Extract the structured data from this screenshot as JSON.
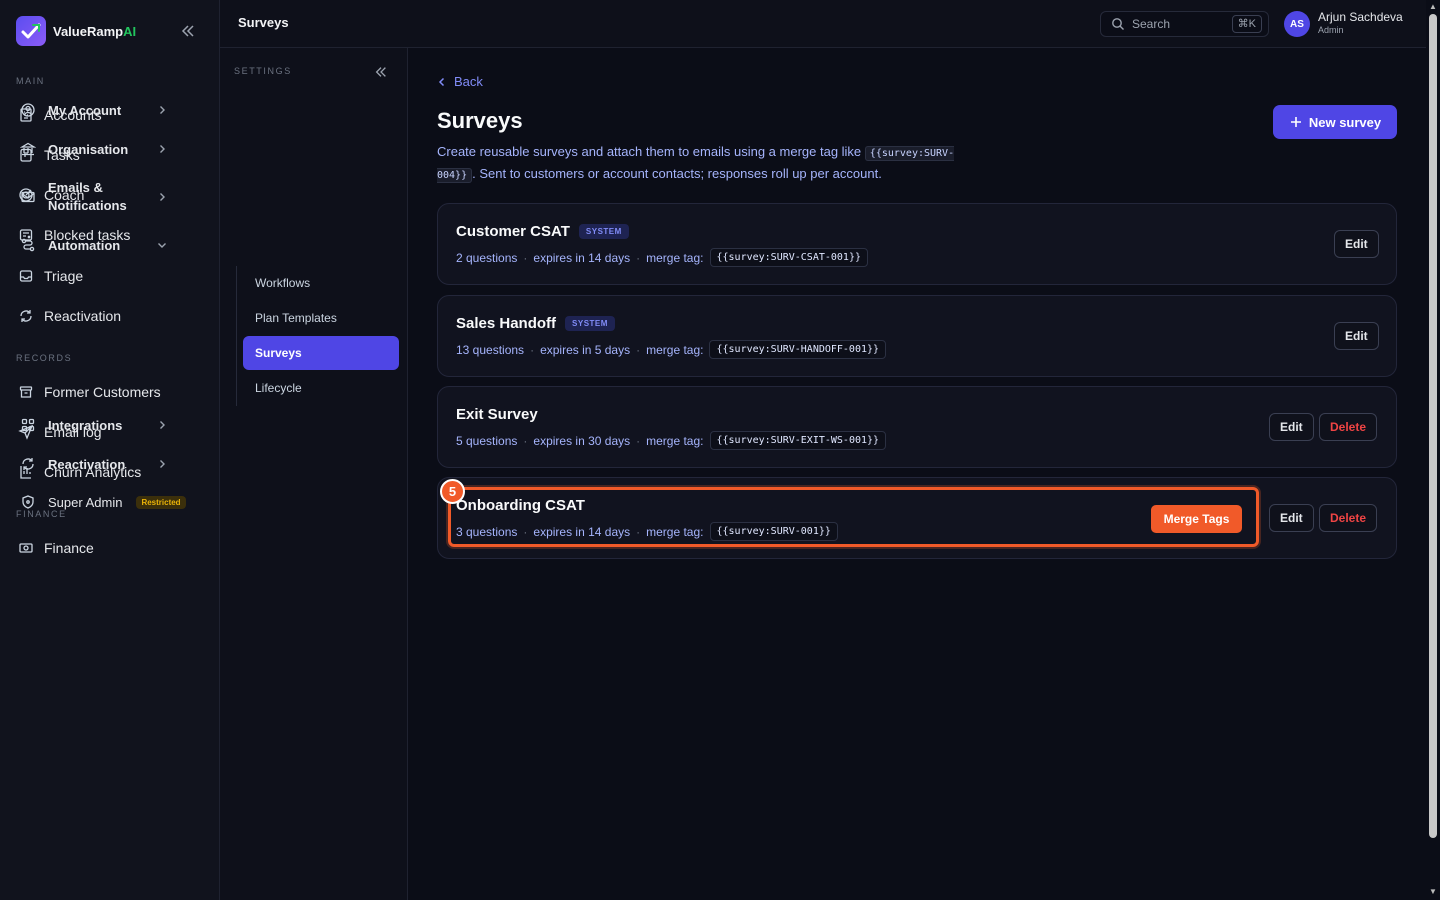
{
  "app": {
    "brand_main": "ValueRamp",
    "brand_ai": "AI"
  },
  "sidebar": {
    "sections": [
      {
        "label": "MAIN"
      },
      {
        "label": "RECORDS"
      },
      {
        "label": "FINANCE"
      }
    ],
    "items": [
      {
        "label": "Accounts",
        "icon": "building-icon"
      },
      {
        "label": "Tasks",
        "icon": "clipboard-icon"
      },
      {
        "label": "Coach",
        "icon": "target-icon"
      },
      {
        "label": "Blocked tasks",
        "icon": "blocked-icon"
      },
      {
        "label": "Triage",
        "icon": "inbox-icon"
      },
      {
        "label": "Reactivation",
        "icon": "refresh-icon"
      },
      {
        "label": "Former Customers",
        "icon": "archive-icon"
      },
      {
        "label": "Email log",
        "icon": "send-icon"
      },
      {
        "label": "Churn Analytics",
        "icon": "chart-icon"
      },
      {
        "label": "Finance",
        "icon": "banknote-icon"
      }
    ]
  },
  "topbar": {
    "title": "Surveys",
    "search_label": "Search",
    "shortcut": "⌘K",
    "user_initials": "AS",
    "user_name": "Arjun Sachdeva",
    "user_role": "Admin"
  },
  "settings": {
    "label": "SETTINGS",
    "items": [
      {
        "label": "My Account"
      },
      {
        "label": "Organisation"
      },
      {
        "label": "Emails & Notifications"
      },
      {
        "label": "Automation"
      },
      {
        "label": "Integrations"
      },
      {
        "label": "Reactivation"
      },
      {
        "label": "Super Admin",
        "badge": "Restricted"
      }
    ],
    "automation_sub": [
      {
        "label": "Workflows"
      },
      {
        "label": "Plan Templates"
      },
      {
        "label": "Surveys"
      },
      {
        "label": "Lifecycle"
      }
    ]
  },
  "main": {
    "back_label": "Back",
    "title": "Surveys",
    "desc_before": "Create reusable surveys and attach them to emails using a merge tag like",
    "desc_code": "{{survey:SURV-004}}",
    "desc_after": ". Sent to customers or account contacts; responses roll up per account.",
    "new_button": "New survey",
    "merge_tag_label": "merge tag:",
    "edit_label": "Edit",
    "delete_label": "Delete",
    "surveys": [
      {
        "title": "Customer CSAT",
        "badge": "SYSTEM",
        "questions": "2 questions",
        "expires": "expires in 14 days",
        "tag": "{{survey:SURV-CSAT-001}}"
      },
      {
        "title": "Sales Handoff",
        "badge": "SYSTEM",
        "questions": "13 questions",
        "expires": "expires in 5 days",
        "tag": "{{survey:SURV-HANDOFF-001}}"
      },
      {
        "title": "Exit Survey",
        "badge": "",
        "questions": "5 questions",
        "expires": "expires in 30 days",
        "tag": "{{survey:SURV-EXIT-WS-001}}"
      },
      {
        "title": "Onboarding CSAT",
        "badge": "",
        "questions": "3 questions",
        "expires": "expires in 14 days",
        "tag": "{{survey:SURV-001}}"
      }
    ],
    "highlight_number": "5",
    "merge_tags_button": "Merge Tags"
  },
  "colors": {
    "accent": "#4f46e5",
    "highlight": "#f15a29",
    "danger": "#ef4444"
  }
}
